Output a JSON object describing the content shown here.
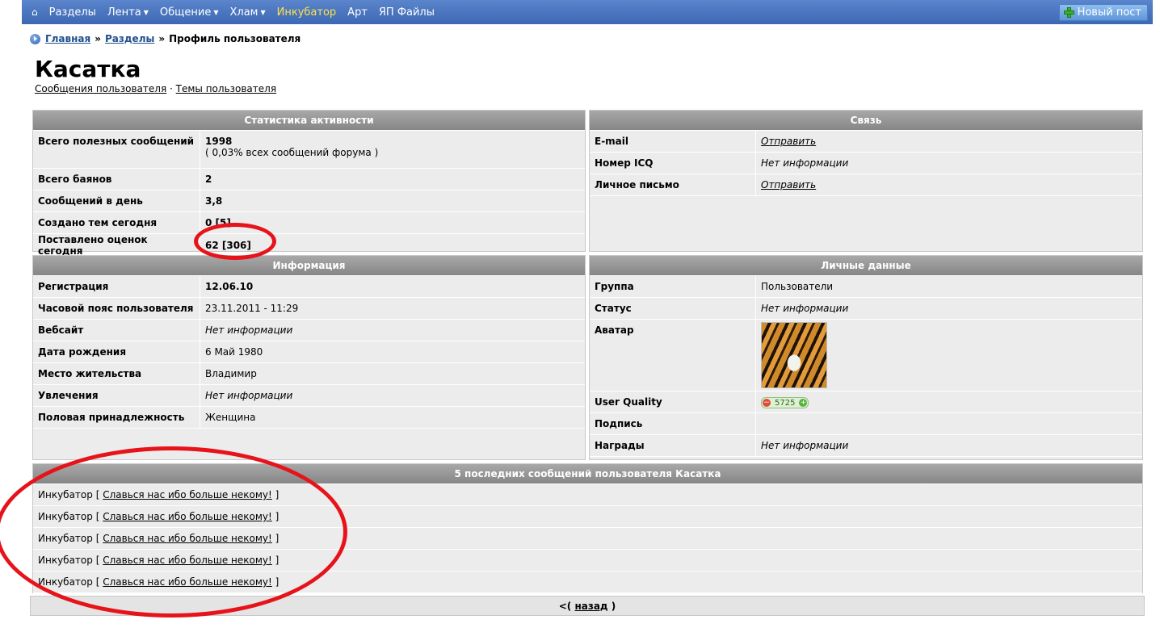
{
  "nav": {
    "home_icon": "house-icon",
    "items": [
      {
        "label": "Разделы",
        "dropdown": false,
        "highlight": false
      },
      {
        "label": "Лента",
        "dropdown": true,
        "highlight": false
      },
      {
        "label": "Общение",
        "dropdown": true,
        "highlight": false
      },
      {
        "label": "Хлам",
        "dropdown": true,
        "highlight": false
      },
      {
        "label": "Инкубатор",
        "dropdown": false,
        "highlight": true
      },
      {
        "label": "Арт",
        "dropdown": false,
        "highlight": false
      },
      {
        "label": "ЯП Файлы",
        "dropdown": false,
        "highlight": false
      }
    ],
    "new_post": "Новый пост",
    "caret": "▼",
    "home": "⌂"
  },
  "breadcrumb": {
    "home": "Главная",
    "sections": "Разделы",
    "sep": "»",
    "current": "Профиль пользователя"
  },
  "profile": {
    "name": "Касатка",
    "link_messages": "Сообщения пользователя",
    "link_sep": "·",
    "link_topics": "Темы пользователя"
  },
  "activity": {
    "title": "Статистика активности",
    "rows": [
      {
        "label": "Всего полезных сообщений",
        "value": "1998",
        "note": "( 0,03% всех сообщений форума )"
      },
      {
        "label": "Всего баянов",
        "value": "2"
      },
      {
        "label": "Сообщений в день",
        "value": "3,8"
      },
      {
        "label": "Создано тем сегодня",
        "value": "0 [5]"
      },
      {
        "label": "Поставлено оценок сегодня",
        "value": "62 [306]"
      }
    ]
  },
  "contact": {
    "title": "Связь",
    "rows": [
      {
        "label": "E-mail",
        "value": "Отправить"
      },
      {
        "label": "Номер ICQ",
        "value": "Нет информации"
      },
      {
        "label": "Личное письмо",
        "value": "Отправить"
      }
    ]
  },
  "info": {
    "title": "Информация",
    "rows": [
      {
        "label": "Регистрация",
        "value": "12.06.10"
      },
      {
        "label": "Часовой пояс пользователя",
        "value": "23.11.2011 - 11:29"
      },
      {
        "label": "Вебсайт",
        "value": "Нет информации"
      },
      {
        "label": "Дата рождения",
        "value": "6 Май 1980"
      },
      {
        "label": "Место жительства",
        "value": "Владимир"
      },
      {
        "label": "Увлечения",
        "value": "Нет информации"
      },
      {
        "label": "Половая принадлежность",
        "value": "Женщина"
      }
    ]
  },
  "personal": {
    "title": "Личные данные",
    "rows": [
      {
        "label": "Группа",
        "value": "Пользователи"
      },
      {
        "label": "Статус",
        "value": "Нет информации"
      },
      {
        "label": "Аватар",
        "value": "tiger-avatar"
      },
      {
        "label": "User Quality",
        "value": "5725",
        "minus": "−",
        "plus": "+"
      },
      {
        "label": "Подпись",
        "value": ""
      },
      {
        "label": "Награды",
        "value": "Нет информации"
      }
    ]
  },
  "recent": {
    "title": "5 последних сообщений пользователя Касатка",
    "open": "[",
    "close": "]",
    "posts": [
      {
        "section": "Инкубатор",
        "topic": "Славься нас ибо больше некому!"
      },
      {
        "section": "Инкубатор",
        "topic": "Славься нас ибо больше некому!"
      },
      {
        "section": "Инкубатор",
        "topic": "Славься нас ибо больше некому!"
      },
      {
        "section": "Инкубатор",
        "topic": "Славься нас ибо больше некому!"
      },
      {
        "section": "Инкубатор",
        "topic": "Славься нас ибо больше некому!"
      }
    ]
  },
  "back": {
    "prefix": "<(",
    "link": "назад",
    "suffix": ")"
  },
  "colors": {
    "nav_bg": "#4a76c0",
    "highlight": "#ffe24a",
    "annotation": "#e6141a"
  }
}
